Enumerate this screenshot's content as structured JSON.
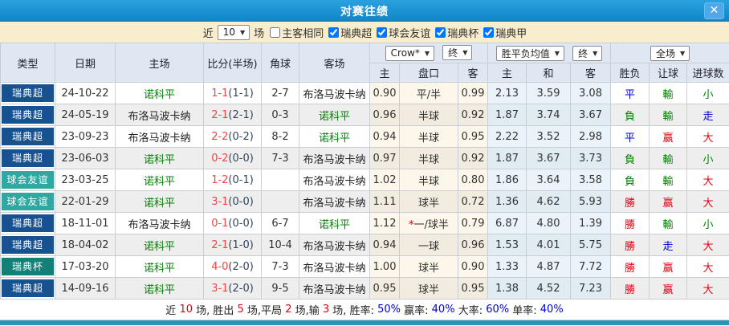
{
  "titlebar": {
    "title": "对赛往绩",
    "close_label": "✕"
  },
  "filters": {
    "recent_label": "近",
    "recent_count": "10",
    "matches_label": "场",
    "checkboxes": [
      {
        "label": "主客相同",
        "checked": false
      },
      {
        "label": "瑞典超",
        "checked": true
      },
      {
        "label": "球会友谊",
        "checked": true
      },
      {
        "label": "瑞典杯",
        "checked": true
      },
      {
        "label": "瑞典甲",
        "checked": true
      }
    ]
  },
  "header": {
    "col_type": "类型",
    "col_date": "日期",
    "col_home": "主场",
    "col_score": "比分(半场)",
    "col_corners": "角球",
    "col_away": "客场",
    "select_crow": "Crow*",
    "select_crow_final": "终",
    "select_avg": "胜平负均值",
    "select_avg_final": "终",
    "select_fulltime": "全场",
    "sub_home_odds": "主",
    "sub_handicap": "盘口",
    "sub_away_odds": "客",
    "sub_avg_home": "主",
    "sub_avg_draw": "和",
    "sub_avg_away": "客",
    "sub_wdl": "胜负",
    "sub_hcap": "让球",
    "sub_goals": "进球数"
  },
  "table": {
    "rows": [
      {
        "type": "瑞典超",
        "type_color": "super",
        "date": "24-10-22",
        "home": "诺科平",
        "home_color": "green",
        "score_ft": "1-1",
        "score_ht": "(1-1)",
        "corners": "2-7",
        "away": "布洛马波卡纳",
        "away_color": "black",
        "crow_home": "0.90",
        "handicap_star": "",
        "handicap": "平/半",
        "crow_away": "0.99",
        "avg_home": "2.13",
        "avg_draw": "3.59",
        "avg_away": "3.08",
        "wdl": "平",
        "wdl_color": "blue",
        "hcap": "輸",
        "hcap_color": "green",
        "goals": "小",
        "goals_color": "green"
      },
      {
        "type": "瑞典超",
        "type_color": "super",
        "date": "24-05-19",
        "home": "布洛马波卡纳",
        "home_color": "black",
        "score_ft": "2-1",
        "score_ht": "(2-1)",
        "corners": "0-3",
        "away": "诺科平",
        "away_color": "green",
        "crow_home": "0.96",
        "handicap_star": "",
        "handicap": "半球",
        "crow_away": "0.92",
        "avg_home": "1.87",
        "avg_draw": "3.74",
        "avg_away": "3.67",
        "wdl": "負",
        "wdl_color": "green",
        "hcap": "輸",
        "hcap_color": "green",
        "goals": "走",
        "goals_color": "blue"
      },
      {
        "type": "瑞典超",
        "type_color": "super",
        "date": "23-09-23",
        "home": "布洛马波卡纳",
        "home_color": "black",
        "score_ft": "2-2",
        "score_ht": "(0-2)",
        "corners": "8-2",
        "away": "诺科平",
        "away_color": "green",
        "crow_home": "0.94",
        "handicap_star": "",
        "handicap": "半球",
        "crow_away": "0.95",
        "avg_home": "2.22",
        "avg_draw": "3.52",
        "avg_away": "2.98",
        "wdl": "平",
        "wdl_color": "blue",
        "hcap": "赢",
        "hcap_color": "red",
        "goals": "大",
        "goals_color": "red"
      },
      {
        "type": "瑞典超",
        "type_color": "super",
        "date": "23-06-03",
        "home": "诺科平",
        "home_color": "green",
        "score_ft": "0-2",
        "score_ht": "(0-0)",
        "corners": "7-3",
        "away": "布洛马波卡纳",
        "away_color": "black",
        "crow_home": "0.97",
        "handicap_star": "",
        "handicap": "半球",
        "crow_away": "0.92",
        "avg_home": "1.87",
        "avg_draw": "3.67",
        "avg_away": "3.73",
        "wdl": "負",
        "wdl_color": "green",
        "hcap": "輸",
        "hcap_color": "green",
        "goals": "小",
        "goals_color": "green"
      },
      {
        "type": "球会友谊",
        "type_color": "friendly",
        "date": "23-03-25",
        "home": "诺科平",
        "home_color": "green",
        "score_ft": "1-2",
        "score_ht": "(0-1)",
        "corners": "",
        "away": "布洛马波卡纳",
        "away_color": "black",
        "crow_home": "1.02",
        "handicap_star": "",
        "handicap": "半球",
        "crow_away": "0.80",
        "avg_home": "1.86",
        "avg_draw": "3.64",
        "avg_away": "3.58",
        "wdl": "負",
        "wdl_color": "green",
        "hcap": "輸",
        "hcap_color": "green",
        "goals": "大",
        "goals_color": "red"
      },
      {
        "type": "球会友谊",
        "type_color": "friendly",
        "date": "22-01-29",
        "home": "诺科平",
        "home_color": "green",
        "score_ft": "3-1",
        "score_ht": "(0-0)",
        "corners": "",
        "away": "布洛马波卡纳",
        "away_color": "black",
        "crow_home": "1.11",
        "handicap_star": "",
        "handicap": "球半",
        "crow_away": "0.72",
        "avg_home": "1.36",
        "avg_draw": "4.62",
        "avg_away": "5.93",
        "wdl": "勝",
        "wdl_color": "red",
        "hcap": "赢",
        "hcap_color": "red",
        "goals": "大",
        "goals_color": "red"
      },
      {
        "type": "瑞典超",
        "type_color": "super",
        "date": "18-11-01",
        "home": "布洛马波卡纳",
        "home_color": "black",
        "score_ft": "0-1",
        "score_ht": "(0-0)",
        "corners": "6-7",
        "away": "诺科平",
        "away_color": "green",
        "crow_home": "1.12",
        "handicap_star": "*",
        "handicap": "一/球半",
        "crow_away": "0.79",
        "avg_home": "6.87",
        "avg_draw": "4.80",
        "avg_away": "1.39",
        "wdl": "勝",
        "wdl_color": "red",
        "hcap": "輸",
        "hcap_color": "green",
        "goals": "小",
        "goals_color": "green"
      },
      {
        "type": "瑞典超",
        "type_color": "super",
        "date": "18-04-02",
        "home": "诺科平",
        "home_color": "green",
        "score_ft": "2-1",
        "score_ht": "(1-0)",
        "corners": "10-4",
        "away": "布洛马波卡纳",
        "away_color": "black",
        "crow_home": "0.94",
        "handicap_star": "",
        "handicap": "一球",
        "crow_away": "0.96",
        "avg_home": "1.53",
        "avg_draw": "4.01",
        "avg_away": "5.75",
        "wdl": "勝",
        "wdl_color": "red",
        "hcap": "走",
        "hcap_color": "blue",
        "goals": "大",
        "goals_color": "red"
      },
      {
        "type": "瑞典杯",
        "type_color": "cup",
        "date": "17-03-20",
        "home": "诺科平",
        "home_color": "green",
        "score_ft": "4-0",
        "score_ht": "(2-0)",
        "corners": "7-3",
        "away": "布洛马波卡纳",
        "away_color": "black",
        "crow_home": "1.00",
        "handicap_star": "",
        "handicap": "球半",
        "crow_away": "0.90",
        "avg_home": "1.33",
        "avg_draw": "4.87",
        "avg_away": "7.72",
        "wdl": "勝",
        "wdl_color": "red",
        "hcap": "赢",
        "hcap_color": "red",
        "goals": "大",
        "goals_color": "red"
      },
      {
        "type": "瑞典超",
        "type_color": "super",
        "date": "14-09-16",
        "home": "诺科平",
        "home_color": "green",
        "score_ft": "3-1",
        "score_ht": "(2-0)",
        "corners": "9-5",
        "away": "布洛马波卡纳",
        "away_color": "black",
        "crow_home": "0.95",
        "handicap_star": "",
        "handicap": "球半",
        "crow_away": "0.95",
        "avg_home": "1.38",
        "avg_draw": "4.52",
        "avg_away": "7.23",
        "wdl": "勝",
        "wdl_color": "red",
        "hcap": "赢",
        "hcap_color": "red",
        "goals": "大",
        "goals_color": "red"
      }
    ]
  },
  "summary": {
    "segments": [
      {
        "t": "近 ",
        "c": "black"
      },
      {
        "t": "10",
        "c": "red"
      },
      {
        "t": " 场, 胜出 ",
        "c": "black"
      },
      {
        "t": "5",
        "c": "red"
      },
      {
        "t": " 场,平局 ",
        "c": "black"
      },
      {
        "t": "2",
        "c": "red"
      },
      {
        "t": " 场,输 ",
        "c": "black"
      },
      {
        "t": "3",
        "c": "red"
      },
      {
        "t": " 场, 胜率: ",
        "c": "black"
      },
      {
        "t": "50%",
        "c": "blue"
      },
      {
        "t": " 赢率: ",
        "c": "black"
      },
      {
        "t": "40%",
        "c": "blue"
      },
      {
        "t": " 大率: ",
        "c": "black"
      },
      {
        "t": "60%",
        "c": "blue"
      },
      {
        "t": " 单率: ",
        "c": "black"
      },
      {
        "t": "40%",
        "c": "blue"
      }
    ]
  },
  "colors": {
    "title_bar": "#1591D3",
    "league_super_badge": "#17518F",
    "friendly_badge": "#2FA8A2",
    "cup_badge": "#137F77",
    "accent_red": "#E60012",
    "accent_green": "#008000",
    "accent_blue": "#0000D9",
    "filter_bar_bg": "#F8EECD",
    "bottom_strip": "#2A93BB"
  }
}
